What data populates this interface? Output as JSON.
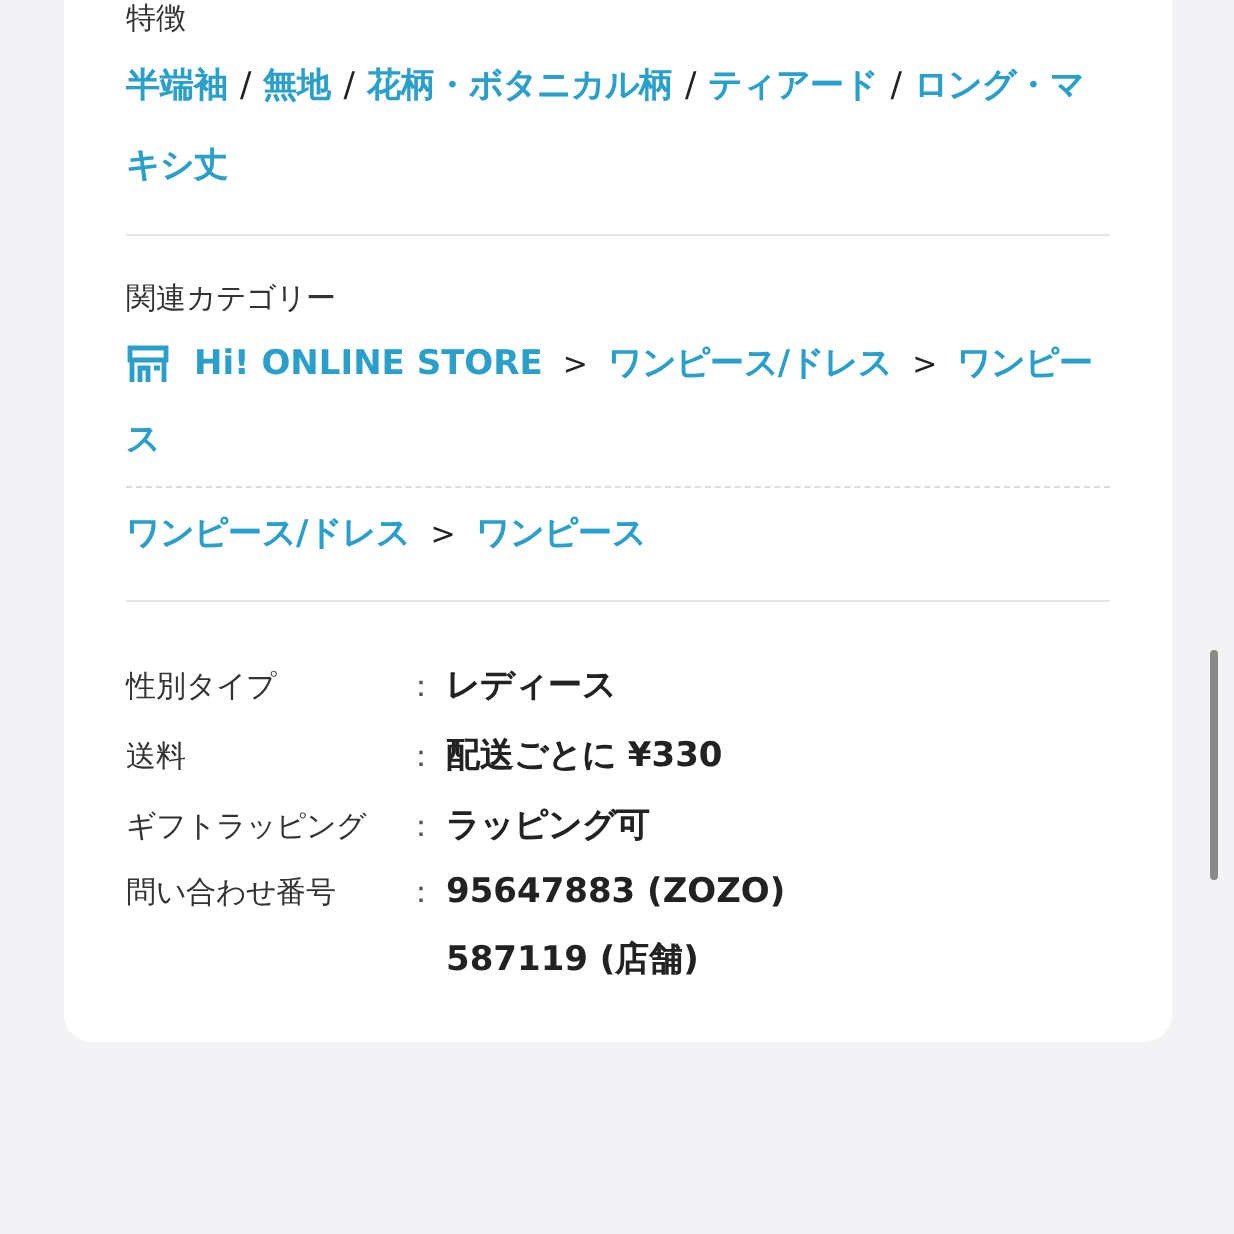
{
  "features": {
    "heading": "特徴",
    "separator": "/",
    "tags": [
      "半端袖",
      "無地",
      "花柄・ボタニカル柄",
      "ティアード",
      "ロング・マキシ丈"
    ]
  },
  "related": {
    "heading": "関連カテゴリー",
    "separator": ">",
    "paths": [
      {
        "items": [
          {
            "label": "Hi! ONLINE STORE",
            "kind": "store"
          },
          {
            "label": "ワンピース/ドレス",
            "kind": "category"
          },
          {
            "label": "ワンピース",
            "kind": "category"
          }
        ]
      },
      {
        "items": [
          {
            "label": "ワンピース/ドレス",
            "kind": "category"
          },
          {
            "label": "ワンピース",
            "kind": "category"
          }
        ]
      }
    ]
  },
  "specs": {
    "separator": "：",
    "rows": [
      {
        "label": "性別タイプ",
        "values": [
          "レディース"
        ]
      },
      {
        "label": "送料",
        "values": [
          "配送ごとに ¥330"
        ]
      },
      {
        "label": "ギフトラッピング",
        "values": [
          "ラッピング可"
        ]
      },
      {
        "label": "問い合わせ番号",
        "values": [
          "95647883 (ZOZO)",
          "587119 (店舗)"
        ]
      }
    ]
  }
}
